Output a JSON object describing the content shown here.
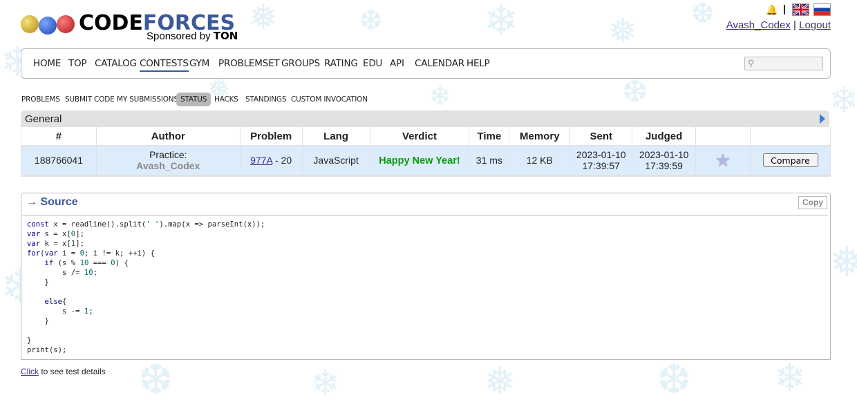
{
  "brand": {
    "name_part1": "CODE",
    "name_part2": "FORCES",
    "sponsor_prefix": "Sponsored by",
    "sponsor_name": "TON"
  },
  "user": {
    "name": "Avash_Codex",
    "separator": "|",
    "logout": "Logout"
  },
  "main_menu": [
    "HOME",
    "TOP",
    "CATALOG",
    "CONTESTS",
    "GYM",
    "PROBLEMSET",
    "GROUPS",
    "RATING",
    "EDU",
    "API",
    "CALENDAR",
    "HELP"
  ],
  "main_menu_active": "CONTESTS",
  "sub_menu": [
    "PROBLEMS",
    "SUBMIT CODE",
    "MY SUBMISSIONS",
    "STATUS",
    "HACKS",
    "STANDINGS",
    "CUSTOM INVOCATION"
  ],
  "sub_menu_active": "STATUS",
  "general": {
    "title": "General",
    "headers": [
      "#",
      "Author",
      "Problem",
      "Lang",
      "Verdict",
      "Time",
      "Memory",
      "Sent",
      "Judged",
      "",
      ""
    ],
    "row": {
      "id": "188766041",
      "author_prefix": "Practice:",
      "author": "Avash_Codex",
      "problem_link": "977A",
      "problem_suffix": " - 20",
      "lang": "JavaScript",
      "verdict": "Happy New Year!",
      "time": "31 ms",
      "memory": "12 KB",
      "sent_date": "2023-01-10",
      "sent_time": "17:39:57",
      "judged_date": "2023-01-10",
      "judged_time": "17:39:59",
      "compare": "Compare"
    }
  },
  "source": {
    "title": "→ Source",
    "copy": "Copy"
  },
  "footer": {
    "link": "Click",
    "text": " to see test details"
  },
  "colors": {
    "accent": "#3b5998",
    "verdict_ok": "#0a9a0a",
    "link": "#3b2d91"
  }
}
